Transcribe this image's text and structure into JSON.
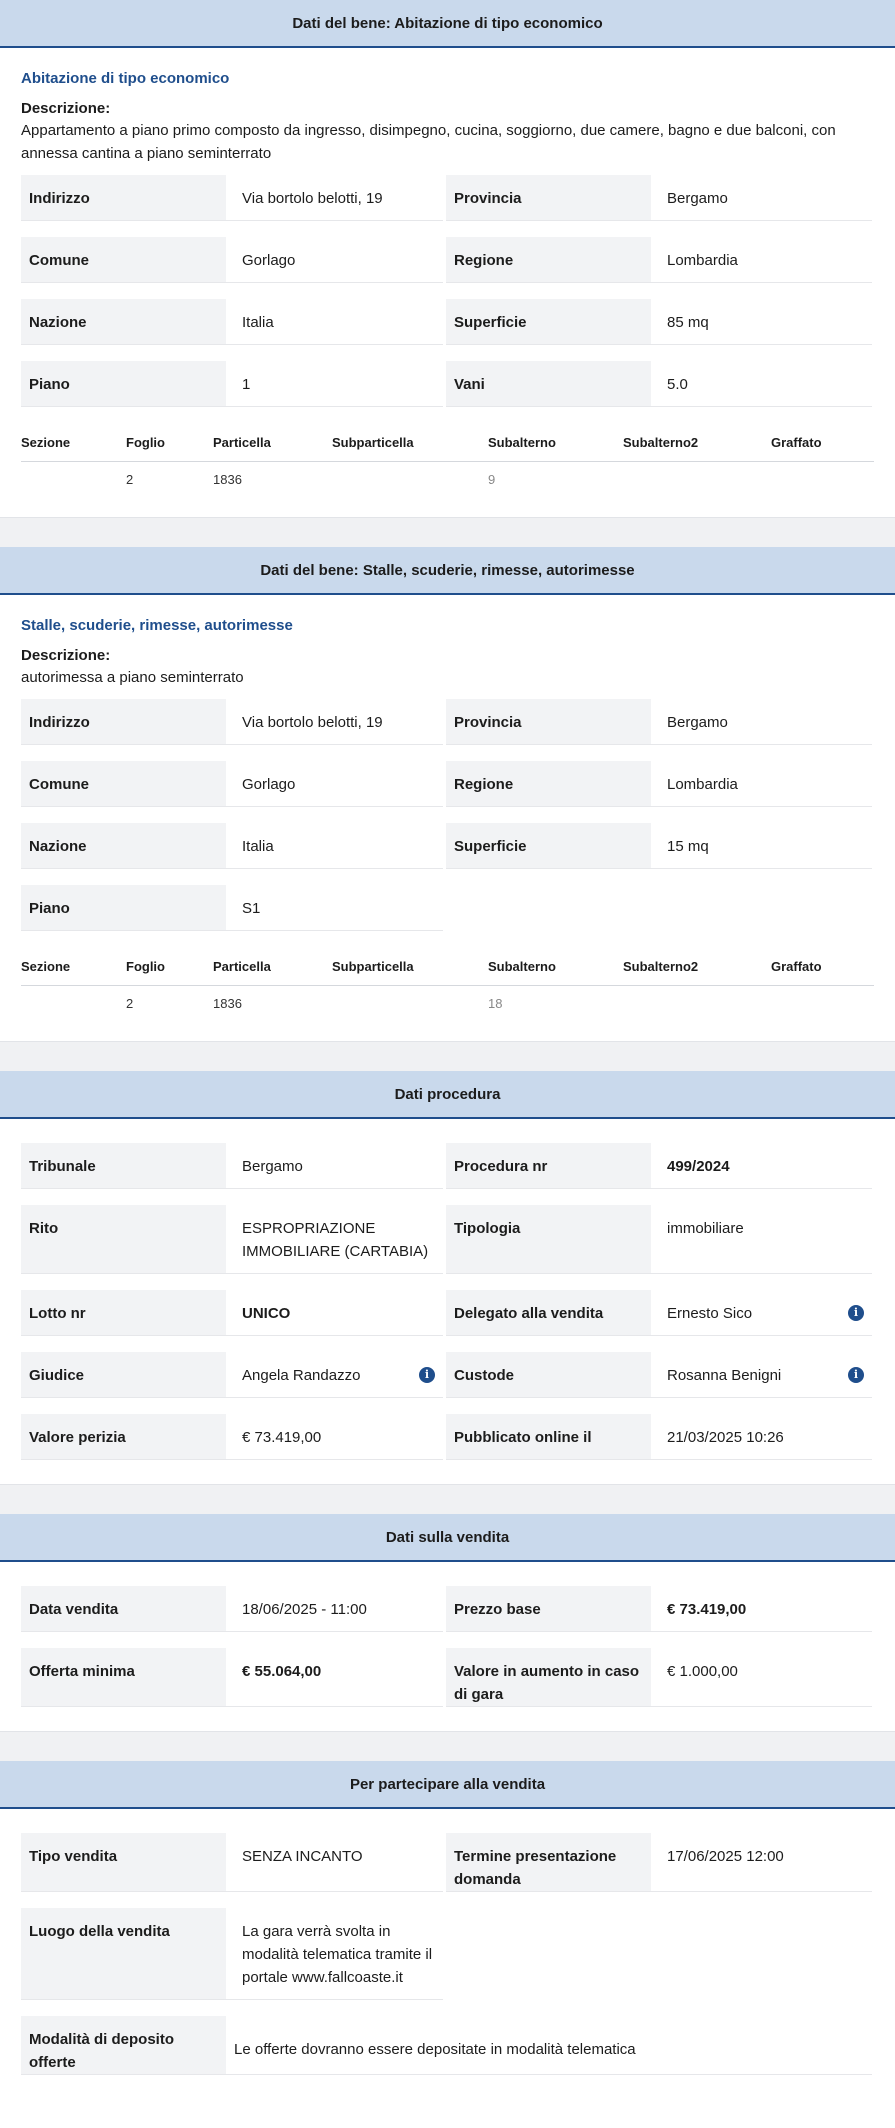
{
  "sections": {
    "bene1": {
      "header": "Dati del bene: Abitazione di tipo economico",
      "title": "Abitazione di tipo economico",
      "desc_label": "Descrizione:",
      "desc_text": "Appartamento a piano primo composto da ingresso, disimpegno, cucina, soggiorno, due camere, bagno e due balconi, con annessa cantina a piano seminterrato",
      "fields": {
        "indirizzo_label": "Indirizzo",
        "indirizzo": "Via bortolo belotti, 19",
        "provincia_label": "Provincia",
        "provincia": "Bergamo",
        "comune_label": "Comune",
        "comune": "Gorlago",
        "regione_label": "Regione",
        "regione": "Lombardia",
        "nazione_label": "Nazione",
        "nazione": "Italia",
        "superficie_label": "Superficie",
        "superficie": "85 mq",
        "piano_label": "Piano",
        "piano": "1",
        "vani_label": "Vani",
        "vani": "5.0"
      },
      "catasto": {
        "headers": [
          "Sezione",
          "Foglio",
          "Particella",
          "Subparticella",
          "Subalterno",
          "Subalterno2",
          "Graffato"
        ],
        "row": [
          "",
          "2",
          "1836",
          "",
          "9",
          "",
          ""
        ]
      }
    },
    "bene2": {
      "header": "Dati del bene: Stalle, scuderie, rimesse, autorimesse",
      "title": "Stalle, scuderie, rimesse, autorimesse",
      "desc_label": "Descrizione:",
      "desc_text": "autorimessa a piano seminterrato",
      "fields": {
        "indirizzo_label": "Indirizzo",
        "indirizzo": "Via bortolo belotti, 19",
        "provincia_label": "Provincia",
        "provincia": "Bergamo",
        "comune_label": "Comune",
        "comune": "Gorlago",
        "regione_label": "Regione",
        "regione": "Lombardia",
        "nazione_label": "Nazione",
        "nazione": "Italia",
        "superficie_label": "Superficie",
        "superficie": "15 mq",
        "piano_label": "Piano",
        "piano": "S1"
      },
      "catasto": {
        "headers": [
          "Sezione",
          "Foglio",
          "Particella",
          "Subparticella",
          "Subalterno",
          "Subalterno2",
          "Graffato"
        ],
        "row": [
          "",
          "2",
          "1836",
          "",
          "18",
          "",
          ""
        ]
      }
    },
    "procedura": {
      "header": "Dati procedura",
      "tribunale_label": "Tribunale",
      "tribunale": "Bergamo",
      "procedura_label": "Procedura nr",
      "procedura": "499/2024",
      "rito_label": "Rito",
      "rito": "ESPROPRIAZIONE IMMOBILIARE (CARTABIA)",
      "tipologia_label": "Tipologia",
      "tipologia": "immobiliare",
      "lotto_label": "Lotto nr",
      "lotto": "UNICO",
      "delegato_label": "Delegato alla vendita",
      "delegato": "Ernesto Sico",
      "giudice_label": "Giudice",
      "giudice": "Angela Randazzo",
      "custode_label": "Custode",
      "custode": "Rosanna Benigni",
      "valore_label": "Valore perizia",
      "valore": "€ 73.419,00",
      "pubblicato_label": "Pubblicato online il",
      "pubblicato": "21/03/2025 10:26"
    },
    "vendita": {
      "header": "Dati sulla vendita",
      "data_label": "Data vendita",
      "data": "18/06/2025 - 11:00",
      "prezzo_label": "Prezzo base",
      "prezzo": "€ 73.419,00",
      "offerta_label": "Offerta minima",
      "offerta": "€ 55.064,00",
      "aumento_label": "Valore in aumento in caso di gara",
      "aumento": "€ 1.000,00"
    },
    "partecipare": {
      "header": "Per partecipare alla vendita",
      "tipo_label": "Tipo vendita",
      "tipo": "SENZA INCANTO",
      "termine_label": "Termine presentazione domanda",
      "termine": "17/06/2025 12:00",
      "luogo_label": "Luogo della vendita",
      "luogo": "La gara verrà svolta in modalità telematica tramite il portale www.fallcoaste.it",
      "deposito_label": "Modalità di deposito offerte",
      "deposito": "Le offerte dovranno essere depositate in modalità telematica"
    }
  },
  "icons": {
    "info": "info-icon",
    "info_glyph": "i"
  },
  "colors": {
    "header_bg": "#c9d9ec",
    "accent": "#1f4e8c",
    "label_bg": "#f2f3f5"
  }
}
